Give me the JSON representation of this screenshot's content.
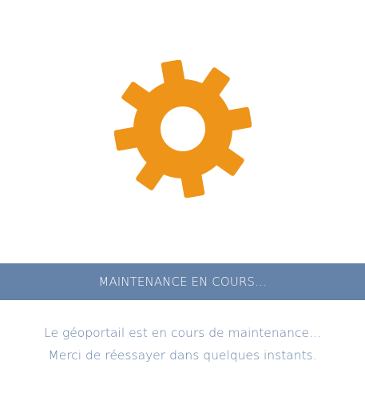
{
  "gear": {
    "icon": "gear-icon",
    "color": "#ee9419"
  },
  "banner": {
    "text": "MAINTENANCE EN COURS...",
    "background": "#6582a8",
    "text_color": "#ffffff"
  },
  "message": {
    "line1": "Le géoportail est en cours de maintenance...",
    "line2": "Merci de réessayer dans quelques instants.",
    "color": "#6582a8"
  }
}
